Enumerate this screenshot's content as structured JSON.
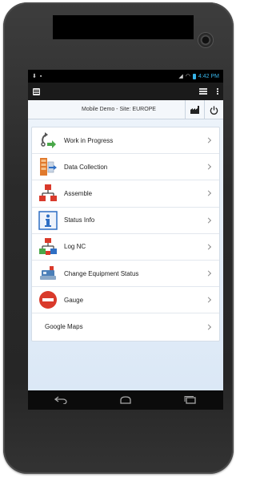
{
  "status_bar": {
    "time": "4:42 PM"
  },
  "header": {
    "title": "Mobile Demo - Site: EUROPE"
  },
  "menu": [
    {
      "label": "Work in Progress",
      "icon": "work-in-progress-icon"
    },
    {
      "label": "Data Collection",
      "icon": "data-collection-icon"
    },
    {
      "label": "Assemble",
      "icon": "assemble-icon"
    },
    {
      "label": "Status Info",
      "icon": "status-info-icon"
    },
    {
      "label": "Log NC",
      "icon": "log-nc-icon"
    },
    {
      "label": "Change Equipment Status",
      "icon": "change-equipment-status-icon"
    },
    {
      "label": "Gauge",
      "icon": "gauge-icon"
    },
    {
      "label": "Google Maps",
      "icon": ""
    }
  ],
  "colors": {
    "accent_green": "#4aa84a",
    "accent_red": "#d93a2b",
    "accent_blue": "#2f6fc4",
    "status_blue": "#37b4e8"
  }
}
